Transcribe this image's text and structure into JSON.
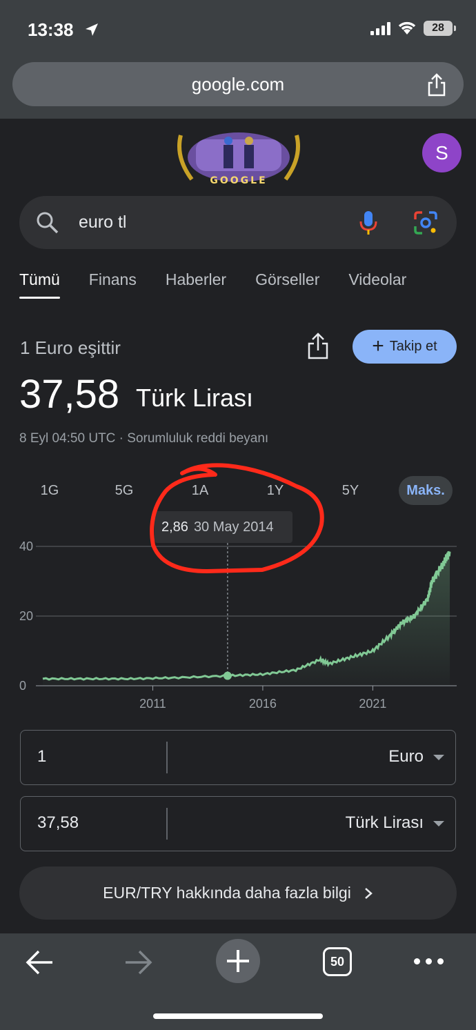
{
  "status": {
    "time": "13:38",
    "battery": "28"
  },
  "browser": {
    "url": "google.com"
  },
  "doodle": {
    "text": "GOOGLE"
  },
  "account": {
    "initial": "S"
  },
  "search": {
    "query": "euro tl"
  },
  "tabs": [
    {
      "label": "Tümü"
    },
    {
      "label": "Finans"
    },
    {
      "label": "Haberler"
    },
    {
      "label": "Görseller"
    },
    {
      "label": "Videolar"
    }
  ],
  "currency": {
    "from_label": "1 Euro eşittir",
    "value": "37,58",
    "unit": "Türk Lirası",
    "meta": "8 Eyl 04:50 UTC · Sorumluluk reddi beyanı",
    "follow_label": "Takip et"
  },
  "ranges": [
    {
      "label": "1G"
    },
    {
      "label": "5G"
    },
    {
      "label": "1A"
    },
    {
      "label": "1Y"
    },
    {
      "label": "5Y"
    },
    {
      "label": "Maks."
    }
  ],
  "tooltip": {
    "value": "2,86",
    "date": "30 May 2014"
  },
  "chart_data": {
    "type": "area",
    "line_color": "#81c995",
    "y_ticks": [
      "0",
      "20",
      "40"
    ],
    "x_ticks": [
      "2011",
      "2016",
      "2021"
    ],
    "ylim": [
      0,
      40
    ],
    "x": [
      "2006",
      "2008",
      "2010",
      "2012",
      "2014.4",
      "2016",
      "2017.5",
      "2018.6",
      "2019",
      "2020",
      "2021",
      "2021.8",
      "2022.3",
      "2022.9",
      "2023.5",
      "2023.7",
      "2024.2",
      "2024.5"
    ],
    "values": [
      2.0,
      2.0,
      2.0,
      2.3,
      2.86,
      3.3,
      4.5,
      7.5,
      6.3,
      8.2,
      10.0,
      14.5,
      18.0,
      20.0,
      25.0,
      30.0,
      35.0,
      38.5
    ],
    "highlight": {
      "x": "2014.4",
      "value": 2.86
    }
  },
  "converter": {
    "from_amount": "1",
    "from_unit": "Euro",
    "to_amount": "37,58",
    "to_unit": "Türk Lirası"
  },
  "more_info": "EUR/TRY hakkında daha fazla bilgi",
  "toolbar": {
    "tab_count": "50"
  }
}
